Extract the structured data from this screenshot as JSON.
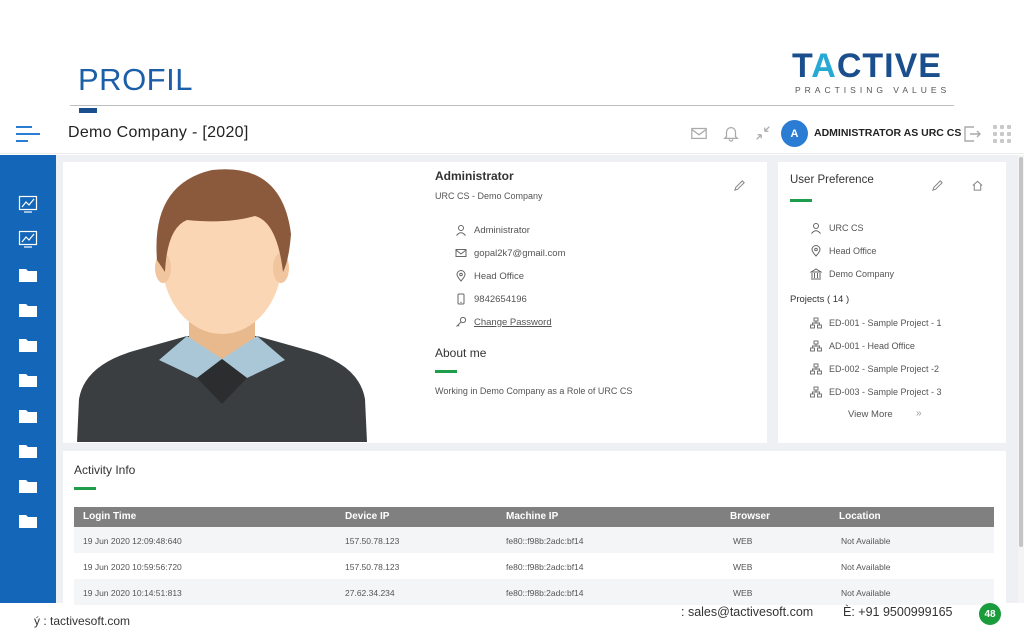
{
  "slide": {
    "title": "PROFIL",
    "logo_prefix": "T",
    "logo_accent": "A",
    "logo_suffix": "CTIVE",
    "logo_tagline": "PRACTISING VALUES"
  },
  "topbar": {
    "company_title": "Demo Company - [2020]",
    "avatar_initial": "A",
    "user_name": "ADMINISTRATOR AS URC CS"
  },
  "profile": {
    "name": "Administrator",
    "subtitle": "URC CS - Demo Company",
    "details": {
      "role": "Administrator",
      "email": "gopal2k7@gmail.com",
      "location": "Head Office",
      "phone": "9842654196",
      "change_password": "Change Password"
    },
    "about_title": "About me",
    "about_text": "Working in Demo Company as a Role of URC CS"
  },
  "preference": {
    "title": "User Preference",
    "role": "URC CS",
    "office": "Head Office",
    "company": "Demo Company",
    "projects_title": "Projects ( 14 )",
    "projects": [
      "ED-001 - Sample Project - 1",
      "AD-001 - Head Office",
      "ED-002 - Sample Project -2",
      "ED-003 - Sample Project - 3"
    ],
    "view_more": "View More",
    "view_more_arrow": "»"
  },
  "activity": {
    "title": "Activity Info",
    "columns": [
      "Login Time",
      "Device IP",
      "Machine IP",
      "Browser",
      "Location"
    ],
    "rows": [
      [
        "19 Jun 2020 12:09:48:640",
        "157.50.78.123",
        "fe80::f98b:2adc:bf14",
        "WEB",
        "Not Available"
      ],
      [
        "19 Jun 2020 10:59:56:720",
        "157.50.78.123",
        "fe80::f98b:2adc:bf14",
        "WEB",
        "Not Available"
      ],
      [
        "19 Jun 2020 10:14:51:813",
        "27.62.34.234",
        "fe80::f98b:2adc:bf14",
        "WEB",
        "Not Available"
      ]
    ]
  },
  "footer": {
    "website": "ý : tactivesoft.com",
    "email": ": sales@tactivesoft.com",
    "phone": "È: +91 9500999165",
    "page_number": "48"
  },
  "colors": {
    "brand_blue": "#1466b8",
    "accent_green": "#1e9e4a",
    "title_blue": "#1a5fa8"
  },
  "icons": {
    "menu": "hamburger-icon",
    "mail": "mail-icon",
    "bell": "bell-icon",
    "collapse": "collapse-icon",
    "logout": "logout-icon",
    "apps": "apps-grid-icon"
  }
}
